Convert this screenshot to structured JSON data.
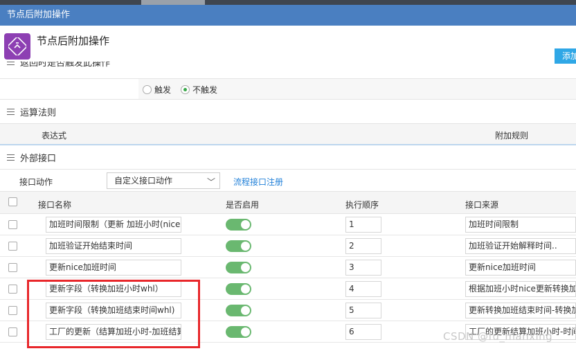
{
  "window": {
    "title": "节点后附加操作"
  },
  "header": {
    "title": "节点后附加操作",
    "add_button": "添加"
  },
  "cut_section": {
    "title": "返回时是否触发此操作"
  },
  "trigger": {
    "options": [
      "触发",
      "不触发"
    ],
    "selected": "不触发"
  },
  "rules": {
    "title": "运算法则",
    "col_expression": "表达式",
    "col_rule": "附加规则"
  },
  "api": {
    "title": "外部接口",
    "action_label": "接口动作",
    "action_value": "自定义接口动作",
    "register_link": "流程接口注册",
    "columns": [
      "接口名称",
      "是否启用",
      "执行顺序",
      "接口来源"
    ],
    "rows": [
      {
        "name": "加班时间限制（更新 加班小时(nice)",
        "enabled": true,
        "order": "1",
        "source": "加班时间限制"
      },
      {
        "name": "加班验证开始结束时间",
        "enabled": true,
        "order": "2",
        "source": "加班验证开始解释时间.."
      },
      {
        "name": "更新nice加班时间",
        "enabled": true,
        "order": "3",
        "source": "更新nice加班时间"
      },
      {
        "name": "更新字段（转换加班小时whl）",
        "enabled": true,
        "order": "4",
        "source": "根据加班小时nice更新转换加班"
      },
      {
        "name": "更新字段（转换加班结束时间whl)",
        "enabled": true,
        "order": "5",
        "source": "更新转换加班结束时间-转换加"
      },
      {
        "name": "工厂的更新（结算加班小时-加班结算",
        "enabled": true,
        "order": "6",
        "source": "工厂的更新结算加班小时-时间"
      }
    ]
  },
  "watermark": "CSDN @fu_manxing",
  "colors": {
    "titlebar": "#4a7fc1",
    "toggle_on": "#6ab870",
    "link": "#1f7fd8",
    "highlight_box": "#e8262a"
  }
}
